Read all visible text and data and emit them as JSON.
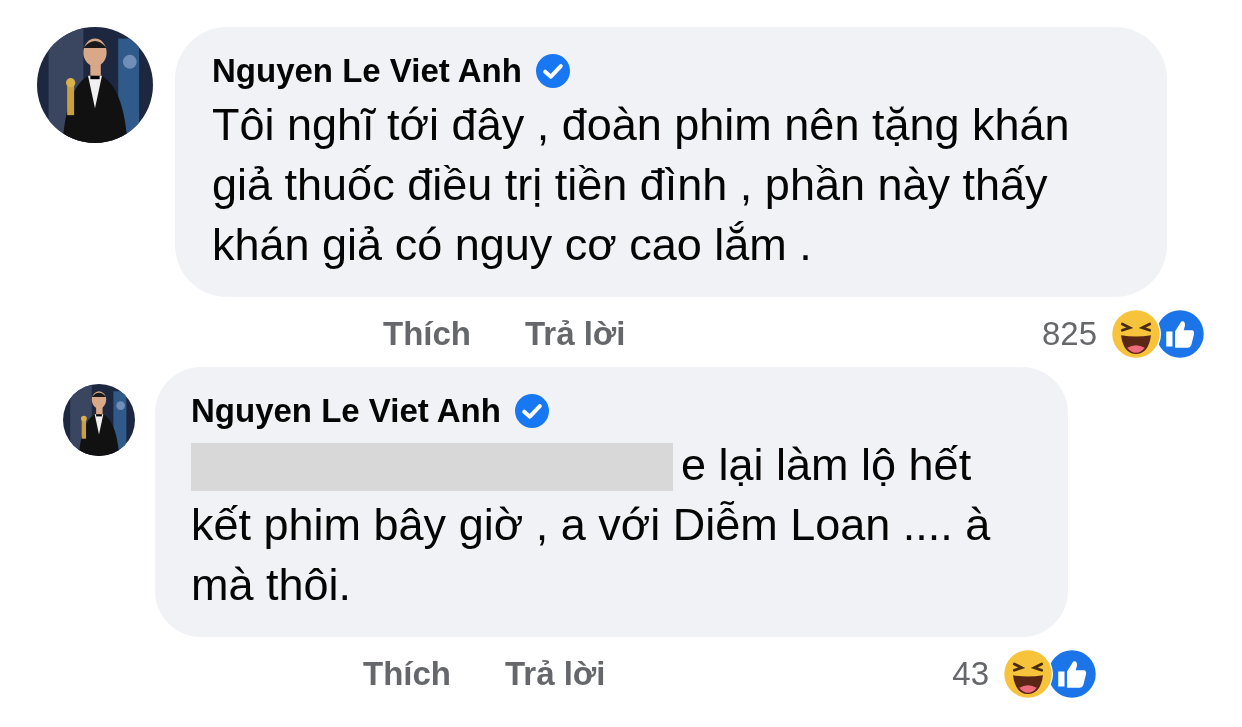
{
  "comments": [
    {
      "reply": false,
      "author": "Nguyen Le Viet Anh",
      "verified": true,
      "mention_redacted": false,
      "text": "Tôi nghĩ tới đây , đoàn phim nên tặng khán giả thuốc điều trị tiền đình , phần này thấy khán giả có nguy cơ cao lắm .",
      "actions": [
        "Thích",
        "Trả lời"
      ],
      "reaction_count": "825",
      "reactions": [
        {
          "kind": "haha"
        },
        {
          "kind": "like"
        }
      ]
    },
    {
      "reply": true,
      "author": "Nguyen Le Viet Anh",
      "verified": true,
      "mention_redacted": true,
      "text": "e lại làm lộ hết kết phim bây giờ , a với Diễm Loan .... à mà thôi.",
      "actions": [
        "Thích",
        "Trả lời"
      ],
      "reaction_count": "43",
      "reactions": [
        {
          "kind": "haha"
        },
        {
          "kind": "like"
        }
      ]
    }
  ]
}
